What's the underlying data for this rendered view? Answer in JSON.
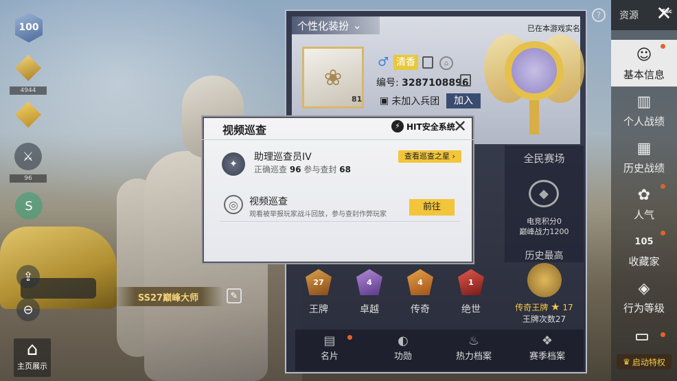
{
  "left": {
    "level": "100",
    "rank_value": "4944",
    "weapon_level": "96",
    "home_show_label": "主页展示",
    "title_plate": "SS27巅峰大师"
  },
  "profile": {
    "personal_tab": "个性化装扮",
    "verified_text": "已在本游戏实名",
    "player_name": "清香",
    "id_label": "编号:",
    "id_value": "3287108896",
    "squad_text": "未加入兵团",
    "join_label": "加入",
    "avatar_level": "81",
    "mode_title": "全民赛场",
    "mode_score": "电竞积分0",
    "mode_power": "巅峰战力1200",
    "history_best": "历史最高",
    "history_rank": "传奇王牌",
    "history_rank_num": "17",
    "history_count": "王牌次数27",
    "tiers": [
      {
        "label": "王牌",
        "num": "27"
      },
      {
        "label": "卓越",
        "num": "4"
      },
      {
        "label": "传奇",
        "num": "4"
      },
      {
        "label": "绝世",
        "num": "1"
      }
    ],
    "bottom_tabs": [
      "名片",
      "功勋",
      "热力档案",
      "赛季档案"
    ]
  },
  "sidebar": {
    "resources_label": "资源",
    "esc_label": "Esc",
    "items": [
      "基本信息",
      "个人战绩",
      "历史战绩",
      "人气",
      "收藏家",
      "行为等级"
    ],
    "collector_num": "105",
    "launch_label": "启动特权"
  },
  "modal": {
    "title": "视频巡查",
    "logo_text": "HIT安全系统",
    "row1_title": "助理巡查员IV",
    "row1_correct_label": "正确巡查",
    "row1_correct_value": "96",
    "row1_ban_label": "参与查封",
    "row1_ban_value": "68",
    "star_button": "查看巡查之星",
    "row2_title": "视频巡查",
    "row2_sub": "观看被举报玩家战斗回放，参与查封作弊玩家",
    "go_button": "前往"
  }
}
